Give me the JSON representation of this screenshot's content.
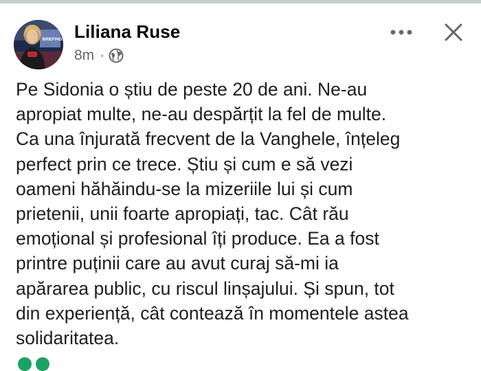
{
  "post": {
    "author_name": "Liliana Ruse",
    "timestamp": "8m",
    "separator": "·",
    "privacy_icon": "globe-icon",
    "avatar_badge_text": "BRIEFING",
    "menu_icon": "more-horizontal-icon",
    "close_icon": "close-icon",
    "body_text": "Pe Sidonia o știu de peste 20 de ani. Ne-au\napropiat multe, ne-au despărțit la fel de multe.\nCa una înjurată frecvent de la Vanghele, înțeleg\nperfect prin ce trece. Știu și cum e să vezi\noameni hăhăindu-se la mizeriile lui și cum\nprietenii, unii foarte apropiați, tac. Cât rău\nemoțional și profesional îți produce. Ea a fost\nprintre puținii care au avut curaj să-mi ia\napărarea public, cu riscul linșajului. Și spun, tot\ndin experiență, cât contează în momentele astea\nsolidaritatea."
  },
  "colors": {
    "background": "#ffffff",
    "primary_text": "#1c1e21",
    "secondary_text": "#65676b",
    "icon": "#606770",
    "reaction_green": "#1aa364"
  }
}
